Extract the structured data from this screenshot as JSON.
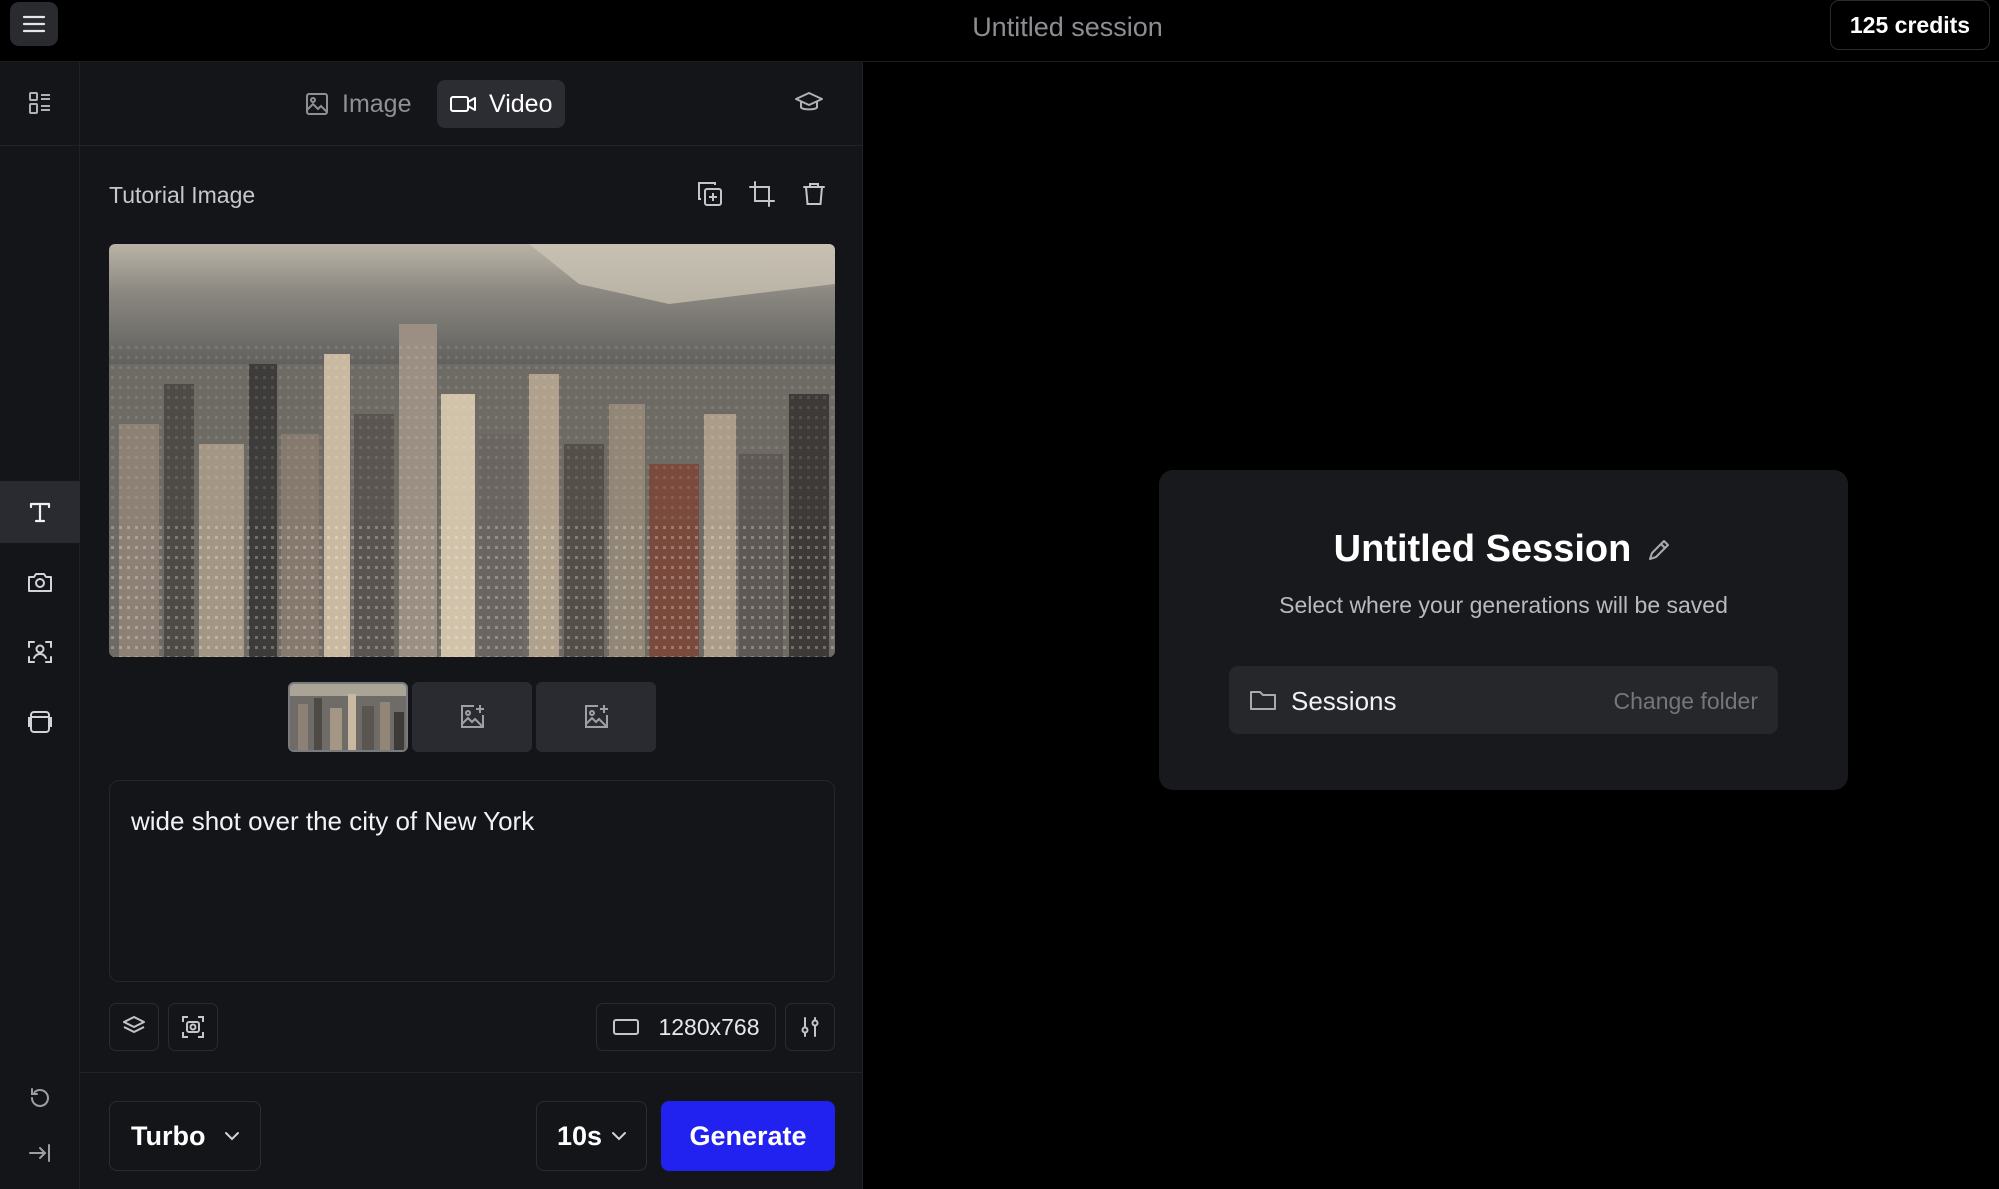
{
  "topbar": {
    "menu_icon": "hamburger-menu-icon",
    "session_title": "Untitled session",
    "credits": "125 credits"
  },
  "mode_tabs": [
    {
      "label": "Image",
      "icon": "image-icon",
      "active": false
    },
    {
      "label": "Video",
      "icon": "video-camera-icon",
      "active": true
    }
  ],
  "rail": {
    "top_icon": "layout-list-icon",
    "items": [
      {
        "icon": "text-icon",
        "active": true
      },
      {
        "icon": "camera-icon",
        "active": false
      },
      {
        "icon": "face-scan-icon",
        "active": false
      },
      {
        "icon": "frames-icon",
        "active": false
      }
    ],
    "bottom_icons": [
      "undo-icon",
      "collapse-panel-icon"
    ]
  },
  "image_section": {
    "title": "Tutorial Image",
    "tools": [
      "duplicate-icon",
      "crop-icon",
      "trash-icon"
    ],
    "thumbnails": [
      "selected-image",
      "add-image",
      "add-image"
    ]
  },
  "prompt": {
    "text": "wide shot over the city of New York"
  },
  "controls": {
    "resolution": "1280x768",
    "model": "Turbo",
    "duration": "10s",
    "generate_label": "Generate"
  },
  "session_card": {
    "title": "Untitled Session",
    "subtitle": "Select where your generations will be saved",
    "folder_name": "Sessions",
    "change_folder_label": "Change folder"
  },
  "colors": {
    "accent": "#2121f0",
    "panel_bg": "#141518",
    "card_bg": "#18191c"
  }
}
